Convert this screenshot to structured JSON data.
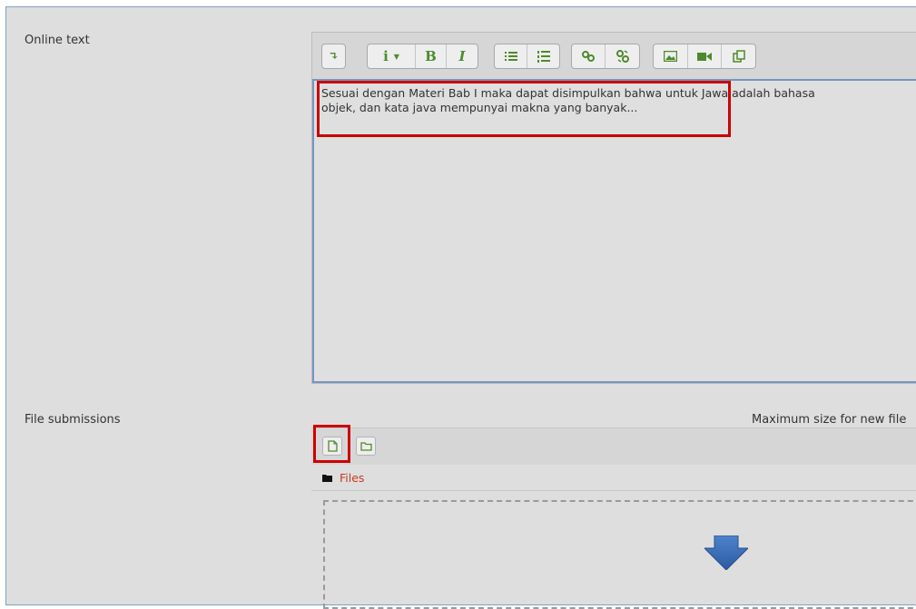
{
  "online_text": {
    "label": "Online text",
    "toolbar": {
      "buttons": [
        {
          "name": "collapse-button",
          "glyph": "↴"
        },
        {
          "name": "paragraph-styles-button",
          "glyph": "i ▾"
        },
        {
          "name": "bold-button",
          "glyph": "B"
        },
        {
          "name": "italic-button",
          "glyph": "I"
        },
        {
          "name": "unordered-list-button",
          "glyph": "☰"
        },
        {
          "name": "ordered-list-button",
          "glyph": "⋮☰"
        },
        {
          "name": "link-button",
          "glyph": "🔗"
        },
        {
          "name": "unlink-button",
          "glyph": "⛓"
        },
        {
          "name": "image-button",
          "glyph": "▣"
        },
        {
          "name": "media-button",
          "glyph": "■"
        },
        {
          "name": "manage-files-button",
          "glyph": "⧉"
        }
      ]
    },
    "line1": "Sesuai dengan Materi Bab I maka dapat disimpulkan bahwa untuk Jawa adalah bahasa",
    "line2": "objek, dan kata java mempunyai makna yang banyak..."
  },
  "file_submissions": {
    "label": "File submissions",
    "max_size_text": "Maximum size for new file",
    "files_path": "Files"
  },
  "colors": {
    "highlight": "#cc0000",
    "toolbar_icon": "#4e8a2d",
    "files_link": "#c83a1f",
    "dropzone_arrow": "#3b6db3"
  },
  "icons": {
    "add-file": "add-file-icon",
    "create-folder": "create-folder-icon",
    "folder": "folder-icon",
    "drop-arrow": "arrow-down-icon"
  }
}
